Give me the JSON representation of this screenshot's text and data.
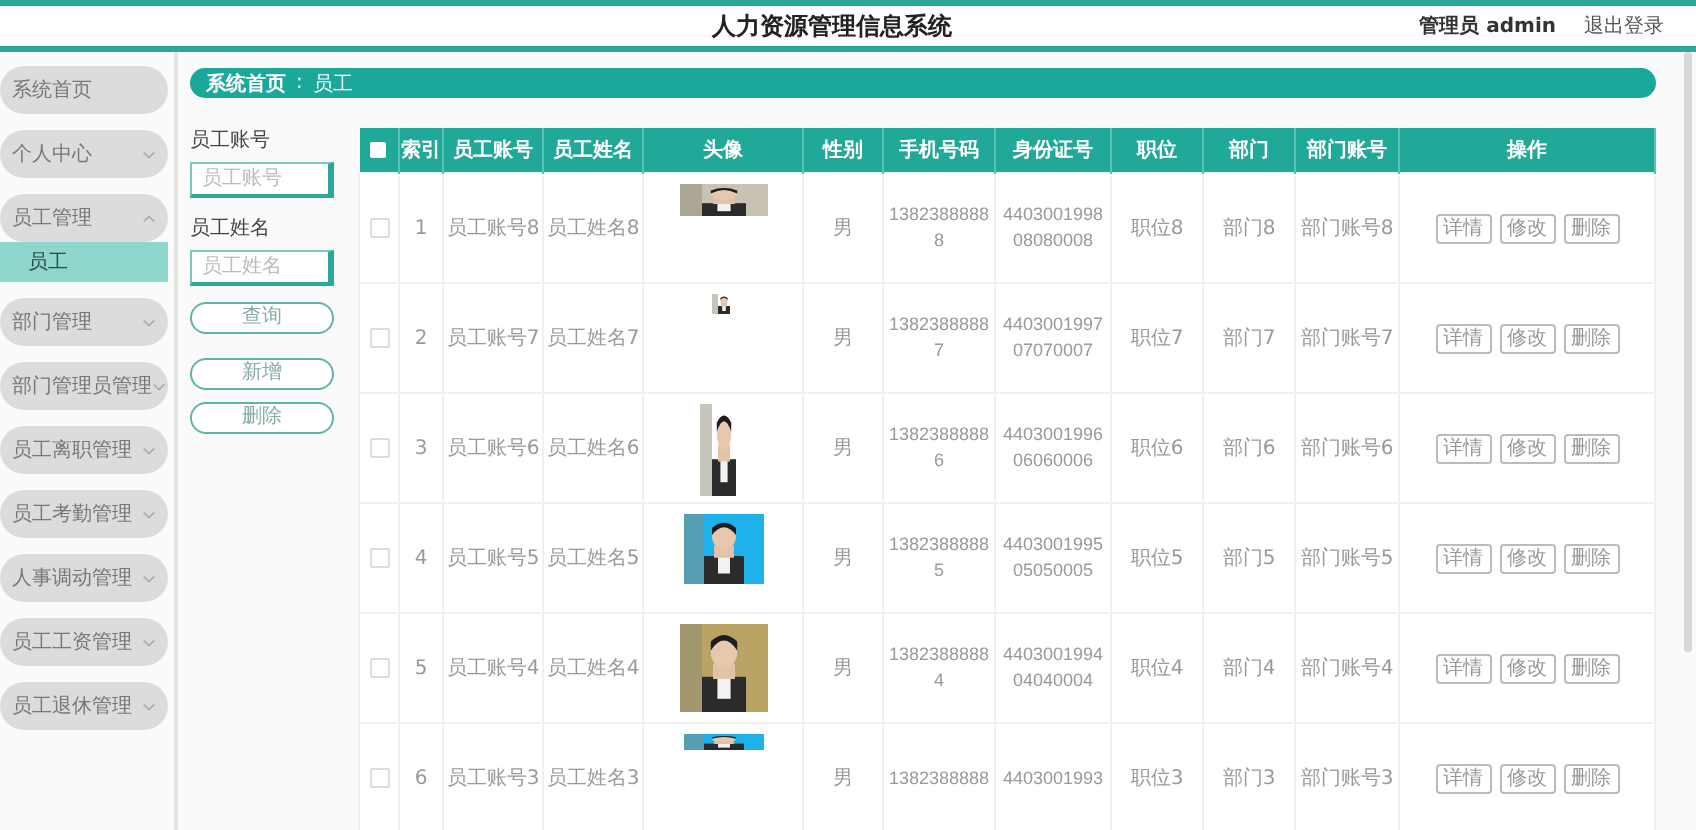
{
  "header": {
    "title": "人力资源管理信息系统",
    "user": "管理员 admin",
    "logout": "退出登录"
  },
  "sidebar": {
    "items": [
      {
        "label": "系统首页",
        "selected": false
      },
      {
        "label": "个人中心",
        "selected": false,
        "expanded": false
      },
      {
        "label": "员工管理",
        "selected": false,
        "expanded": true,
        "children": [
          {
            "label": "员工",
            "selected": true
          }
        ]
      },
      {
        "label": "部门管理",
        "selected": false,
        "expanded": false
      },
      {
        "label": "部门管理员管理",
        "selected": false,
        "expanded": false
      },
      {
        "label": "员工离职管理",
        "selected": false,
        "expanded": false
      },
      {
        "label": "员工考勤管理",
        "selected": false,
        "expanded": false
      },
      {
        "label": "人事调动管理",
        "selected": false,
        "expanded": false
      },
      {
        "label": "员工工资管理",
        "selected": false,
        "expanded": false
      },
      {
        "label": "员工退休管理",
        "selected": false,
        "expanded": false
      }
    ]
  },
  "breadcrumb": {
    "home": "系统首页",
    "separator": ":",
    "current": "员工"
  },
  "search": {
    "fields": [
      {
        "label": "员工账号",
        "placeholder": "员工账号"
      },
      {
        "label": "员工姓名",
        "placeholder": "员工姓名"
      }
    ],
    "buttons": [
      "查询",
      "新增",
      "删除"
    ]
  },
  "table": {
    "select_all_checked": false,
    "columns": [
      "索引",
      "员工账号",
      "员工姓名",
      "头像",
      "性别",
      "手机号码",
      "身份证号",
      "职位",
      "部门",
      "部门账号",
      "操作"
    ],
    "rows": [
      {
        "checked": false,
        "index": "1",
        "account": "员工账号8",
        "name": "员工姓名8",
        "gender": "男",
        "phone": "13823888888",
        "id_number": "440300199808080008",
        "position": "职位8",
        "dept": "部门8",
        "dept_account": "部门账号8",
        "actions": [
          "详情",
          "修改",
          "删除"
        ]
      },
      {
        "checked": false,
        "index": "2",
        "account": "员工账号7",
        "name": "员工姓名7",
        "gender": "男",
        "phone": "13823888887",
        "id_number": "440300199707070007",
        "position": "职位7",
        "dept": "部门7",
        "dept_account": "部门账号7",
        "actions": [
          "详情",
          "修改",
          "删除"
        ]
      },
      {
        "checked": false,
        "index": "3",
        "account": "员工账号6",
        "name": "员工姓名6",
        "gender": "男",
        "phone": "13823888886",
        "id_number": "440300199606060006",
        "position": "职位6",
        "dept": "部门6",
        "dept_account": "部门账号6",
        "actions": [
          "详情",
          "修改",
          "删除"
        ]
      },
      {
        "checked": false,
        "index": "4",
        "account": "员工账号5",
        "name": "员工姓名5",
        "gender": "男",
        "phone": "13823888885",
        "id_number": "440300199505050005",
        "position": "职位5",
        "dept": "部门5",
        "dept_account": "部门账号5",
        "actions": [
          "详情",
          "修改",
          "删除"
        ]
      },
      {
        "checked": false,
        "index": "5",
        "account": "员工账号4",
        "name": "员工姓名4",
        "gender": "男",
        "phone": "13823888884",
        "id_number": "440300199404040004",
        "position": "职位4",
        "dept": "部门4",
        "dept_account": "部门账号4",
        "actions": [
          "详情",
          "修改",
          "删除"
        ]
      },
      {
        "checked": false,
        "index": "6",
        "account": "员工账号3",
        "name": "员工姓名3",
        "gender": "男",
        "phone": "1382388888",
        "id_number": "4403001993",
        "position": "职位3",
        "dept": "部门3",
        "dept_account": "部门账号3",
        "actions": [
          "详情",
          "修改",
          "删除"
        ]
      }
    ]
  }
}
